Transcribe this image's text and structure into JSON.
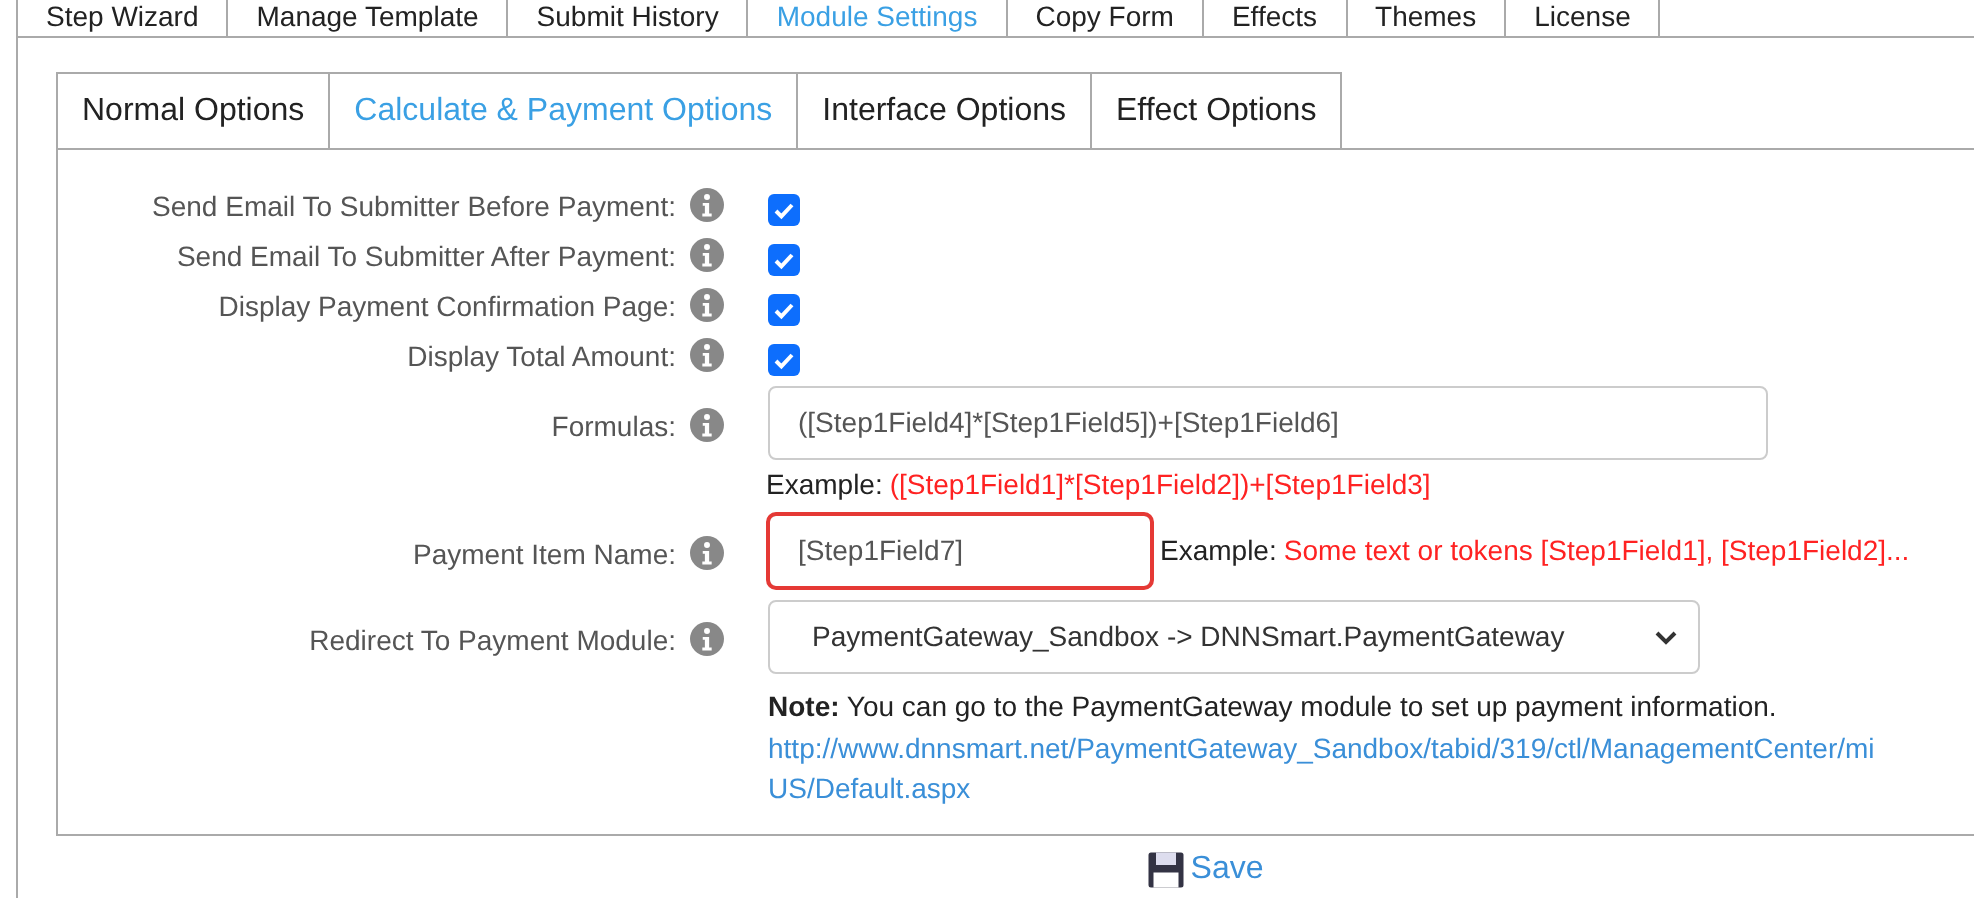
{
  "main_tabs": [
    {
      "label": "Step Wizard",
      "selected": false
    },
    {
      "label": "Manage Template",
      "selected": false
    },
    {
      "label": "Submit History",
      "selected": false
    },
    {
      "label": "Module Settings",
      "selected": true
    },
    {
      "label": "Copy Form",
      "selected": false
    },
    {
      "label": "Effects",
      "selected": false
    },
    {
      "label": "Themes",
      "selected": false
    },
    {
      "label": "License",
      "selected": false
    }
  ],
  "sub_tabs": [
    {
      "label": "Normal Options",
      "selected": false
    },
    {
      "label": "Calculate & Payment Options",
      "selected": true
    },
    {
      "label": "Interface Options",
      "selected": false
    },
    {
      "label": "Effect Options",
      "selected": false
    }
  ],
  "settings": [
    {
      "kind": "checkbox",
      "label": "Send Email To Submitter Before Payment:",
      "checked": true
    },
    {
      "kind": "checkbox",
      "label": "Send Email To Submitter After Payment:",
      "checked": true
    },
    {
      "kind": "checkbox",
      "label": "Display Payment Confirmation Page:",
      "checked": true
    },
    {
      "kind": "checkbox",
      "label": "Display Total Amount:",
      "checked": true
    },
    {
      "kind": "text",
      "label": "Formulas:",
      "value": "([Step1Field4]*[Step1Field5])+[Step1Field6]",
      "highlighted": false,
      "example_label": "Example:",
      "example": "([Step1Field1]*[Step1Field2])+[Step1Field3]",
      "example_inline": false
    },
    {
      "kind": "text",
      "label": "Payment Item Name:",
      "value": "[Step1Field7]",
      "highlighted": true,
      "example_label": "Example:",
      "example": "Some text or tokens [Step1Field1], [Step1Field2]...",
      "example_inline": true
    },
    {
      "kind": "select",
      "label": "Redirect To Payment Module:",
      "value": "PaymentGateway_Sandbox -> DNNSmart.PaymentGateway",
      "note": "**Note:** You can go to the PaymentGateway module to set up payment information.",
      "links": [
        "http://www.dnnsmart.net/PaymentGateway_Sandbox/tabid/319/ctl/ManagementCenter/mi",
        "US/Default.aspx"
      ]
    }
  ],
  "save_button": "Save"
}
